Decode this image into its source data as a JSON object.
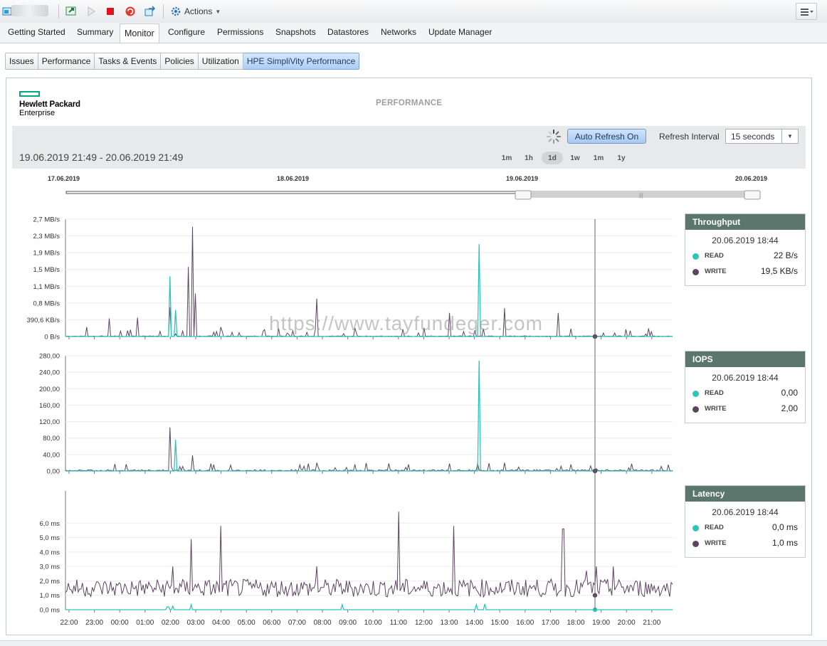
{
  "toolbar": {
    "actions_label": "Actions"
  },
  "tabs": [
    "Getting Started",
    "Summary",
    "Monitor",
    "Configure",
    "Permissions",
    "Snapshots",
    "Datastores",
    "Networks",
    "Update Manager"
  ],
  "subtabs": [
    "Issues",
    "Performance",
    "Tasks & Events",
    "Policies",
    "Utilization",
    "HPE SimpliVity Performance"
  ],
  "logo": {
    "line1": "Hewlett Packard",
    "line2": "Enterprise"
  },
  "page_title": "PERFORMANCE",
  "controls": {
    "auto_refresh": "Auto Refresh On",
    "refresh_interval_label": "Refresh Interval",
    "refresh_interval_value": "15 seconds",
    "date_range": "19.06.2019 21:49 - 20.06.2019 21:49",
    "ranges": [
      "1m",
      "1h",
      "1d",
      "1w",
      "1m",
      "1y"
    ],
    "active_range": "1d"
  },
  "timeline": {
    "dates": [
      "17.06.2019",
      "18.06.2019",
      "19.06.2019",
      "20.06.2019"
    ]
  },
  "watermark": "https://www.tayfundeger.com",
  "colors": {
    "read": "#2ec4bd",
    "write": "#5c4560",
    "legend_header": "#5b776d",
    "accent": "#01a982"
  },
  "legends": [
    {
      "title": "Throughput",
      "timestamp": "20.06.2019 18:44",
      "read_label": "READ",
      "read_value": "22 B/s",
      "write_label": "WRITE",
      "write_value": "19,5 KB/s"
    },
    {
      "title": "IOPS",
      "timestamp": "20.06.2019 18:44",
      "read_label": "READ",
      "read_value": "0,00",
      "write_label": "WRITE",
      "write_value": "2,00"
    },
    {
      "title": "Latency",
      "timestamp": "20.06.2019 18:44",
      "read_label": "READ",
      "read_value": "0,0 ms",
      "write_label": "WRITE",
      "write_value": "1,0 ms"
    }
  ],
  "chart_data": [
    {
      "type": "line",
      "y_ticks": [
        "0 B/s",
        "390,6 KB/s",
        "0,8 MB/s",
        "1,1 MB/s",
        "1,5 MB/s",
        "1,9 MB/s",
        "2,3 MB/s",
        "2,7 MB/s"
      ],
      "y_tick_values": [
        0,
        0.3906,
        0.78,
        1.17,
        1.56,
        1.95,
        2.34,
        2.73
      ],
      "ylim": [
        0,
        2.73
      ],
      "unit": "MB/s",
      "baseline": 0.01,
      "series": [
        {
          "name": "READ",
          "spikes": [
            [
              4.0,
              1.4
            ],
            [
              4.2,
              0.62
            ],
            [
              16.2,
              2.15
            ]
          ]
        },
        {
          "name": "WRITE",
          "spikes": [
            [
              0.7,
              0.22
            ],
            [
              1.6,
              0.42
            ],
            [
              2.7,
              0.44
            ],
            [
              3.6,
              0.12
            ],
            [
              4.0,
              0.68
            ],
            [
              4.7,
              1.62
            ],
            [
              4.9,
              2.55
            ],
            [
              5.0,
              1.0
            ],
            [
              6.0,
              0.22
            ],
            [
              9.8,
              0.88
            ],
            [
              11.3,
              0.2
            ],
            [
              14.0,
              0.2
            ],
            [
              15.0,
              0.55
            ],
            [
              17.2,
              0.66
            ],
            [
              19.3,
              0.55
            ],
            [
              19.8,
              0.18
            ]
          ]
        }
      ]
    },
    {
      "type": "line",
      "y_ticks": [
        "0,00",
        "40,00",
        "80,00",
        "120,00",
        "160,00",
        "200,00",
        "240,00",
        "280,00"
      ],
      "y_tick_values": [
        0,
        40,
        80,
        120,
        160,
        200,
        240,
        280
      ],
      "ylim": [
        0,
        280
      ],
      "baseline": 2,
      "series": [
        {
          "name": "READ",
          "spikes": [
            [
              4.2,
              76
            ],
            [
              16.2,
              268
            ]
          ]
        },
        {
          "name": "WRITE",
          "spikes": [
            [
              4.0,
              106
            ],
            [
              4.9,
              38
            ],
            [
              5.6,
              18
            ],
            [
              9.8,
              20
            ],
            [
              11.3,
              16
            ],
            [
              15.0,
              18
            ],
            [
              17.2,
              20
            ],
            [
              19.8,
              16
            ]
          ]
        }
      ]
    },
    {
      "type": "line",
      "y_ticks": [
        "0,0 ms",
        "1,0 ms",
        "2,0 ms",
        "3,0 ms",
        "4,0 ms",
        "5,0 ms",
        "6,0 ms"
      ],
      "y_tick_values": [
        0,
        1,
        2,
        3,
        4,
        5,
        6
      ],
      "ylim": [
        0,
        7
      ],
      "unit": "ms",
      "baseline": 1.5,
      "x_ticks": [
        "22:00",
        "23:00",
        "00:00",
        "01:00",
        "02:00",
        "03:00",
        "04:00",
        "05:00",
        "06:00",
        "07:00",
        "08:00",
        "09:00",
        "10:00",
        "11:00",
        "12:00",
        "13:00",
        "14:00",
        "15:00",
        "16:00",
        "17:00",
        "18:00",
        "19:00",
        "20:00",
        "21:00"
      ],
      "series": [
        {
          "name": "READ",
          "spikes": [
            [
              3.9,
              0.2
            ],
            [
              4.1,
              0.25
            ],
            [
              4.8,
              0.35
            ],
            [
              10.8,
              0.35
            ],
            [
              16.1,
              0.35
            ],
            [
              16.4,
              0.4
            ]
          ]
        },
        {
          "name": "WRITE",
          "spikes": [
            [
              4.1,
              3.0
            ],
            [
              4.8,
              4.9
            ],
            [
              6.0,
              5.8
            ],
            [
              9.8,
              3.0
            ],
            [
              13.0,
              6.8
            ],
            [
              15.2,
              5.8
            ],
            [
              19.5,
              5.6
            ],
            [
              20.4,
              2.7
            ],
            [
              20.8,
              3.0
            ],
            [
              21.5,
              3.0
            ]
          ]
        }
      ]
    }
  ]
}
